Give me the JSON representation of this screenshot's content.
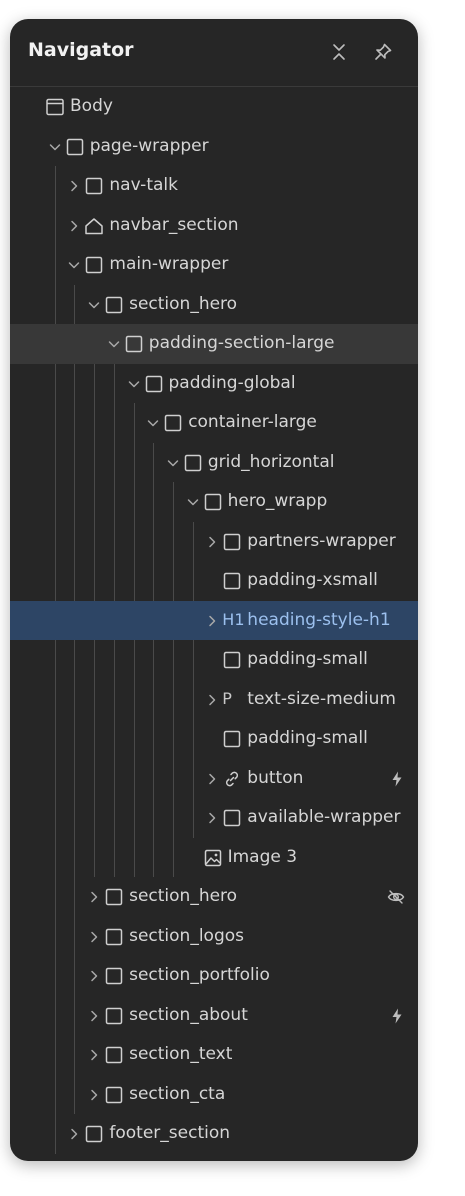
{
  "navigator": {
    "title": "Navigator",
    "collapse_icon": "collapse-all-icon",
    "pin_icon": "pin-icon"
  },
  "tree": [
    {
      "label": "Body",
      "depth": 0,
      "icon": "body-icon",
      "expand": "none"
    },
    {
      "label": "page-wrapper",
      "depth": 1,
      "icon": "box",
      "expand": "open"
    },
    {
      "label": "nav-talk",
      "depth": 2,
      "icon": "box",
      "expand": "closed"
    },
    {
      "label": "navbar_section",
      "depth": 2,
      "icon": "home-icon",
      "expand": "closed"
    },
    {
      "label": "main-wrapper",
      "depth": 2,
      "icon": "box",
      "expand": "open"
    },
    {
      "label": "section_hero",
      "depth": 3,
      "icon": "box",
      "expand": "open"
    },
    {
      "label": "padding-section-large",
      "depth": 4,
      "icon": "box",
      "expand": "open",
      "state": "hover"
    },
    {
      "label": "padding-global",
      "depth": 5,
      "icon": "box",
      "expand": "open"
    },
    {
      "label": "container-large",
      "depth": 6,
      "icon": "box",
      "expand": "open"
    },
    {
      "label": "grid_horizontal",
      "depth": 7,
      "icon": "box",
      "expand": "open"
    },
    {
      "label": "hero_wrapp",
      "depth": 8,
      "icon": "box",
      "expand": "open"
    },
    {
      "label": "partners-wrapper",
      "depth": 9,
      "icon": "box",
      "expand": "closed"
    },
    {
      "label": "padding-xsmall",
      "depth": 9,
      "icon": "box",
      "expand": "none"
    },
    {
      "label": "heading-style-h1",
      "depth": 9,
      "icon": "tag",
      "tag": "H1",
      "expand": "closed",
      "state": "selected"
    },
    {
      "label": "padding-small",
      "depth": 9,
      "icon": "box",
      "expand": "none"
    },
    {
      "label": "text-size-medium",
      "depth": 9,
      "icon": "tag",
      "tag": "P",
      "expand": "closed"
    },
    {
      "label": "padding-small",
      "depth": 9,
      "icon": "box",
      "expand": "none"
    },
    {
      "label": "button",
      "depth": 9,
      "icon": "link-icon",
      "expand": "closed",
      "right_icon": "lightning-icon"
    },
    {
      "label": "available-wrapper",
      "depth": 9,
      "icon": "box",
      "expand": "closed"
    },
    {
      "label": "Image 3",
      "depth": 8,
      "icon": "image-icon",
      "expand": "none"
    },
    {
      "label": "section_hero",
      "depth": 3,
      "icon": "box",
      "expand": "closed",
      "right_icon": "eye-off-icon"
    },
    {
      "label": "section_logos",
      "depth": 3,
      "icon": "box",
      "expand": "closed"
    },
    {
      "label": "section_portfolio",
      "depth": 3,
      "icon": "box",
      "expand": "closed"
    },
    {
      "label": "section_about",
      "depth": 3,
      "icon": "box",
      "expand": "closed",
      "right_icon": "lightning-icon"
    },
    {
      "label": "section_text",
      "depth": 3,
      "icon": "box",
      "expand": "closed"
    },
    {
      "label": "section_cta",
      "depth": 3,
      "icon": "box",
      "expand": "closed"
    },
    {
      "label": "footer_section",
      "depth": 2,
      "icon": "box",
      "expand": "closed"
    }
  ],
  "colors": {
    "panel_bg": "#262626",
    "selected_bg": "#2d4565",
    "selected_text": "#9cc0ee",
    "hover_bg": "#383838",
    "text": "#d6d6d6"
  }
}
